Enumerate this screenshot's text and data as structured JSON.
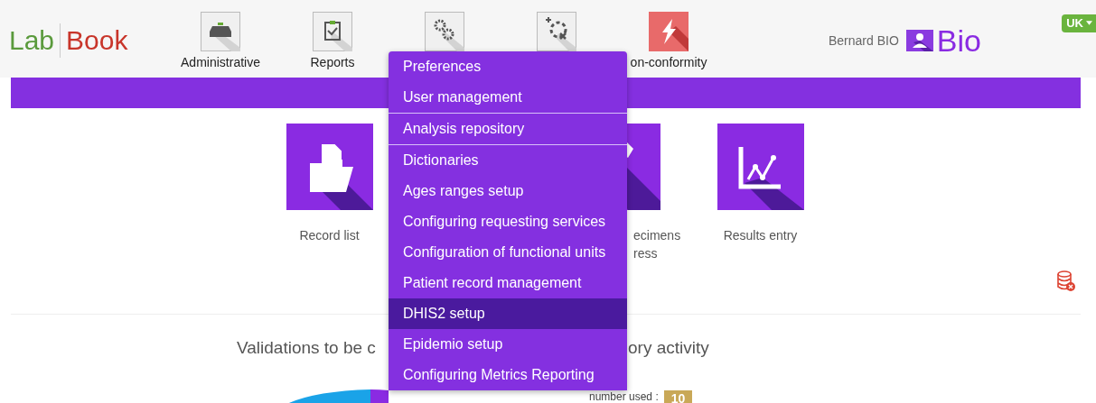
{
  "logo": {
    "first": "Lab",
    "second": "Book"
  },
  "nav": [
    {
      "label": "Administrative",
      "kind": "tray"
    },
    {
      "label": "Reports",
      "kind": "clipboard"
    },
    {
      "kind": "gears"
    },
    {
      "kind": "target"
    },
    {
      "label": "on-conformity",
      "kind": "bolt"
    }
  ],
  "user": {
    "name": "Bernard BIO",
    "brand": "Bio"
  },
  "language": {
    "label": "UK"
  },
  "tiles": [
    {
      "lines": [
        "Record list"
      ],
      "kind": "folder"
    },
    {
      "lines": [
        "ecimens",
        "ress"
      ],
      "kind": "partial"
    },
    {
      "lines": [
        "Results entry"
      ],
      "kind": "chart"
    }
  ],
  "menu": {
    "items": [
      {
        "label": "Preferences",
        "selected": false,
        "separator_after": false
      },
      {
        "label": "User management",
        "selected": false,
        "separator_after": true
      },
      {
        "label": "Analysis repository",
        "selected": false,
        "separator_after": true
      },
      {
        "label": "Dictionaries",
        "selected": false,
        "separator_after": false
      },
      {
        "label": "Ages ranges setup",
        "selected": false,
        "separator_after": false
      },
      {
        "label": "Configuring requesting services",
        "selected": false,
        "separator_after": false
      },
      {
        "label": "Configuration of functional units",
        "selected": false,
        "separator_after": false
      },
      {
        "label": "Patient record management",
        "selected": false,
        "separator_after": false
      },
      {
        "label": "DHIS2 setup",
        "selected": true,
        "separator_after": false
      },
      {
        "label": "Epidemio setup",
        "selected": false,
        "separator_after": false
      },
      {
        "label": "Configuring Metrics Reporting",
        "selected": false,
        "separator_after": false
      }
    ]
  },
  "dashboard": {
    "left_title": "Validations to be c",
    "right_title": "ory activity",
    "counter_label": "number used :",
    "counter_value": "10"
  }
}
